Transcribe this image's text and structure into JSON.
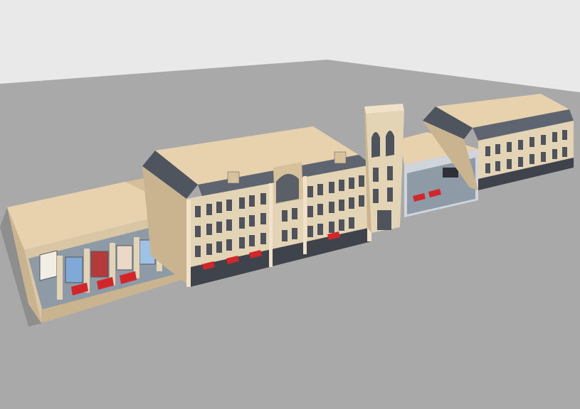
{
  "scene": {
    "colors": {
      "sky": "#e9e9e9",
      "ground": "#a9a9a9",
      "facade": "#e4d4b6",
      "facade_shadow": "#c9b48f",
      "roof_flat": "#e8d2ad",
      "mansard": "#5f6570",
      "glass": "#8e9aa6",
      "awning": "#d3262a"
    },
    "buildings": [
      {
        "name": "glass-podium-shop"
      },
      {
        "name": "mansard-main-block"
      },
      {
        "name": "clock-tower"
      },
      {
        "name": "mid-glass-shop"
      },
      {
        "name": "east-mansard-block"
      }
    ]
  }
}
